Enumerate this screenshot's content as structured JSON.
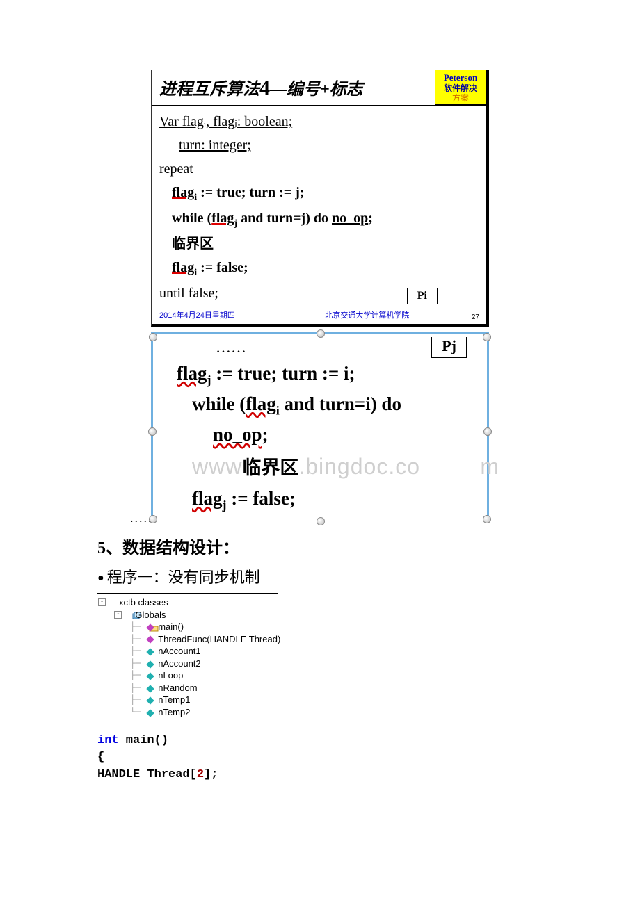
{
  "slide1": {
    "title_part1": "进程互斥算法",
    "title_num": "4",
    "title_part2": "—编号+标志",
    "peterson": {
      "l1": "Peterson",
      "l2": "软件解决",
      "l3": "方案"
    },
    "line1": "Var flagᵢ, flagⱼ: boolean;",
    "line2": "turn: integer;",
    "line3": "repeat",
    "line4a": "flag",
    "line4a_sub": "i",
    "line4b": " := true;   turn := j;",
    "line5a": "while (",
    "line5b": "flag",
    "line5b_sub": "j",
    "line5c": " and turn=j)  do ",
    "line5d": "no_op",
    "line5e": ";",
    "line6": "临界区",
    "line7a": "flag",
    "line7a_sub": "i",
    "line7b": " := false;",
    "line8": "until false;",
    "pi": "Pi",
    "footer_date": "2014年4月24日星期四",
    "footer_mid": "北京交通大学计算机学院",
    "footer_page": "27"
  },
  "slide2": {
    "dots": "……",
    "pj": "Pj",
    "l1a": "flag",
    "l1a_sub": "j",
    "l1b": " := true;   turn := i;",
    "l2a": "while (",
    "l2b": "flag",
    "l2b_sub": "i",
    "l2c": " and turn=i)  do",
    "l3a": "no_op",
    "l3b": ";",
    "wm1": "www",
    "cn_lj": "临界区",
    "wm2": ".bingdoc.co",
    "wm3": "m",
    "l5a": "flag",
    "l5a_sub": "j",
    "l5b": " := false;"
  },
  "sec5": {
    "heading": "5、数据结构设计：",
    "sub": "程序一：没有同步机制"
  },
  "tree": {
    "root": "xctb classes",
    "globals": "Globals",
    "items": [
      "main()",
      "ThreadFunc(HANDLE Thread)",
      "nAccount1",
      "nAccount2",
      "nLoop",
      "nRandom",
      "nTemp1",
      "nTemp2"
    ]
  },
  "code": {
    "l1_kw": "int",
    "l1_rest": " main()",
    "l2": "{",
    "l3a": " HANDLE Thread[",
    "l3_num": "2",
    "l3b": "];"
  }
}
